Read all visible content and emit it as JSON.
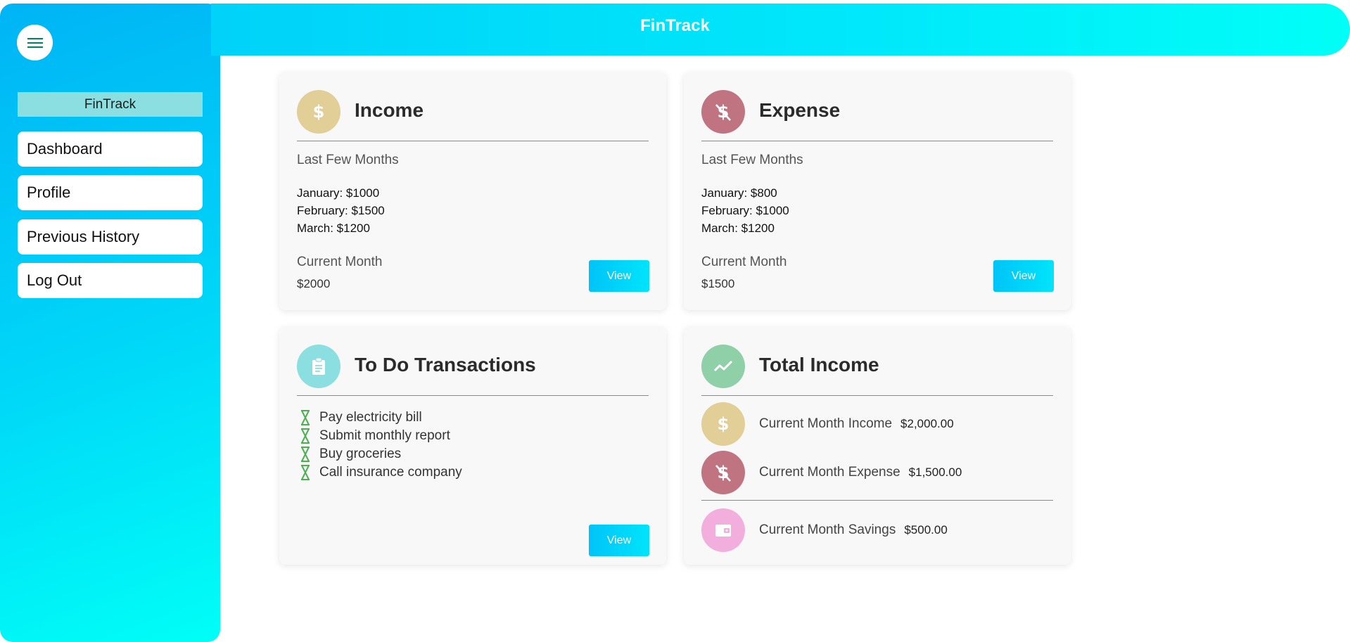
{
  "app": {
    "title": "FinTrack"
  },
  "sidebar": {
    "brand": "FinTrack",
    "items": [
      {
        "label": "Dashboard"
      },
      {
        "label": "Profile"
      },
      {
        "label": "Previous History"
      },
      {
        "label": "Log Out"
      }
    ]
  },
  "income": {
    "title": "Income",
    "subtitle": "Last Few Months",
    "months": [
      "January: $1000",
      "February: $1500",
      "March: $1200"
    ],
    "current_label": "Current Month",
    "current_value": "$2000",
    "button": "View",
    "icon": "dollar-icon",
    "color": "#e2cf98"
  },
  "expense": {
    "title": "Expense",
    "subtitle": "Last Few Months",
    "months": [
      "January: $800",
      "February: $1000",
      "March: $1200"
    ],
    "current_label": "Current Month",
    "current_value": "$1500",
    "button": "View",
    "icon": "money-off-icon",
    "color": "#c07482"
  },
  "todo": {
    "title": "To Do Transactions",
    "items": [
      "Pay electricity bill",
      "Submit monthly report",
      "Buy groceries",
      "Call insurance company"
    ],
    "button": "View",
    "icon": "clipboard-icon",
    "color": "#8bdfe0",
    "item_icon": "hourglass-icon",
    "item_icon_color": "#4caf50"
  },
  "total_income": {
    "title": "Total Income",
    "icon": "trending-up-icon",
    "color": "#8fd0a8",
    "rows": [
      {
        "label": "Current Month Income",
        "value": "$2,000.00",
        "icon": "dollar-icon",
        "color": "#e2cf98"
      },
      {
        "label": "Current Month Expense",
        "value": "$1,500.00",
        "icon": "money-off-icon",
        "color": "#c07482"
      },
      {
        "label": "Current Month Savings",
        "value": "$500.00",
        "icon": "wallet-icon",
        "color": "#f2aedc"
      }
    ]
  }
}
